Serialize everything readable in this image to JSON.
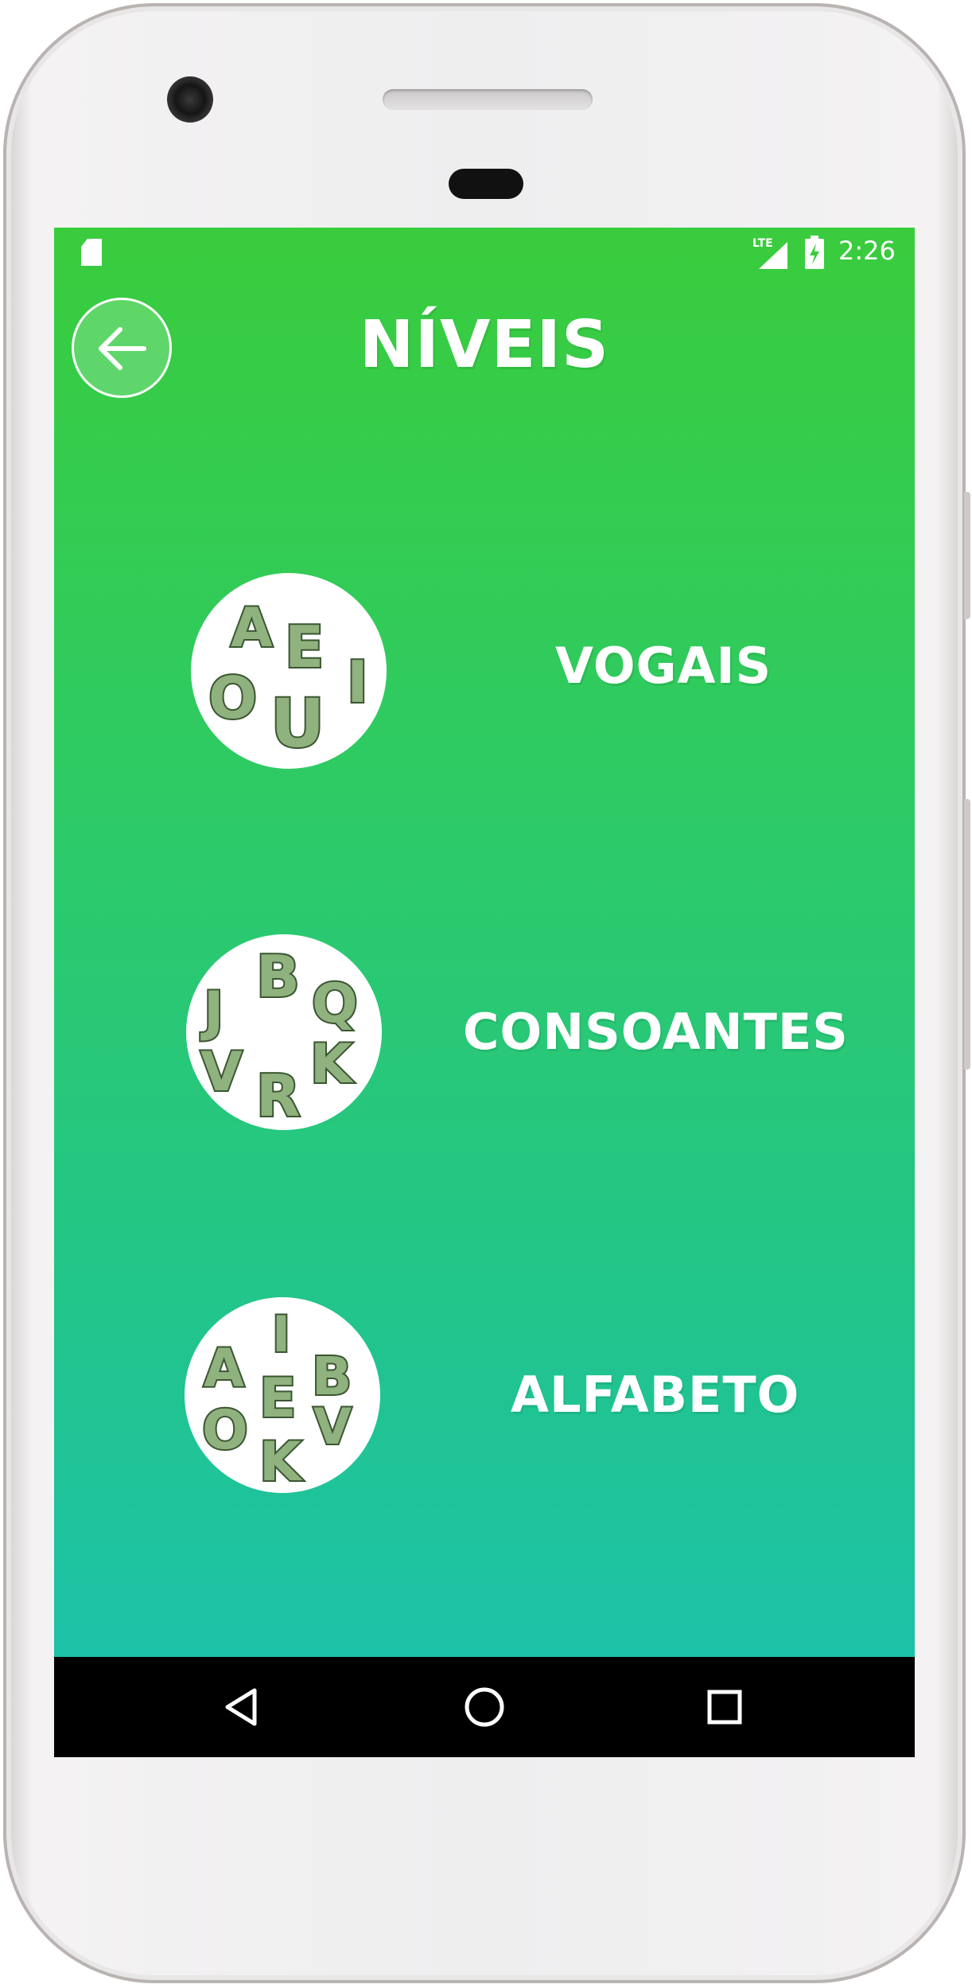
{
  "status_bar": {
    "network": "LTE",
    "time": "2:26"
  },
  "header": {
    "title": "NÍVEIS",
    "back_icon": "arrow-left-icon"
  },
  "levels": [
    {
      "label": "VOGAIS",
      "letters": [
        "A",
        "E",
        "I",
        "O",
        "U"
      ]
    },
    {
      "label": "CONSOANTES",
      "letters": [
        "J",
        "B",
        "Q",
        "V",
        "R",
        "K"
      ]
    },
    {
      "label": "ALFABETO",
      "letters": [
        "A",
        "I",
        "B",
        "E",
        "O",
        "V",
        "K"
      ]
    }
  ],
  "nav_bar": {
    "back_icon": "triangle-back-icon",
    "home_icon": "circle-home-icon",
    "recents_icon": "square-recents-icon"
  },
  "colors": {
    "gradient_top": "#3acc3d",
    "gradient_bottom": "#1bc1b0",
    "letter_fill": "#8fb27e",
    "letter_stroke": "#3b5632"
  }
}
